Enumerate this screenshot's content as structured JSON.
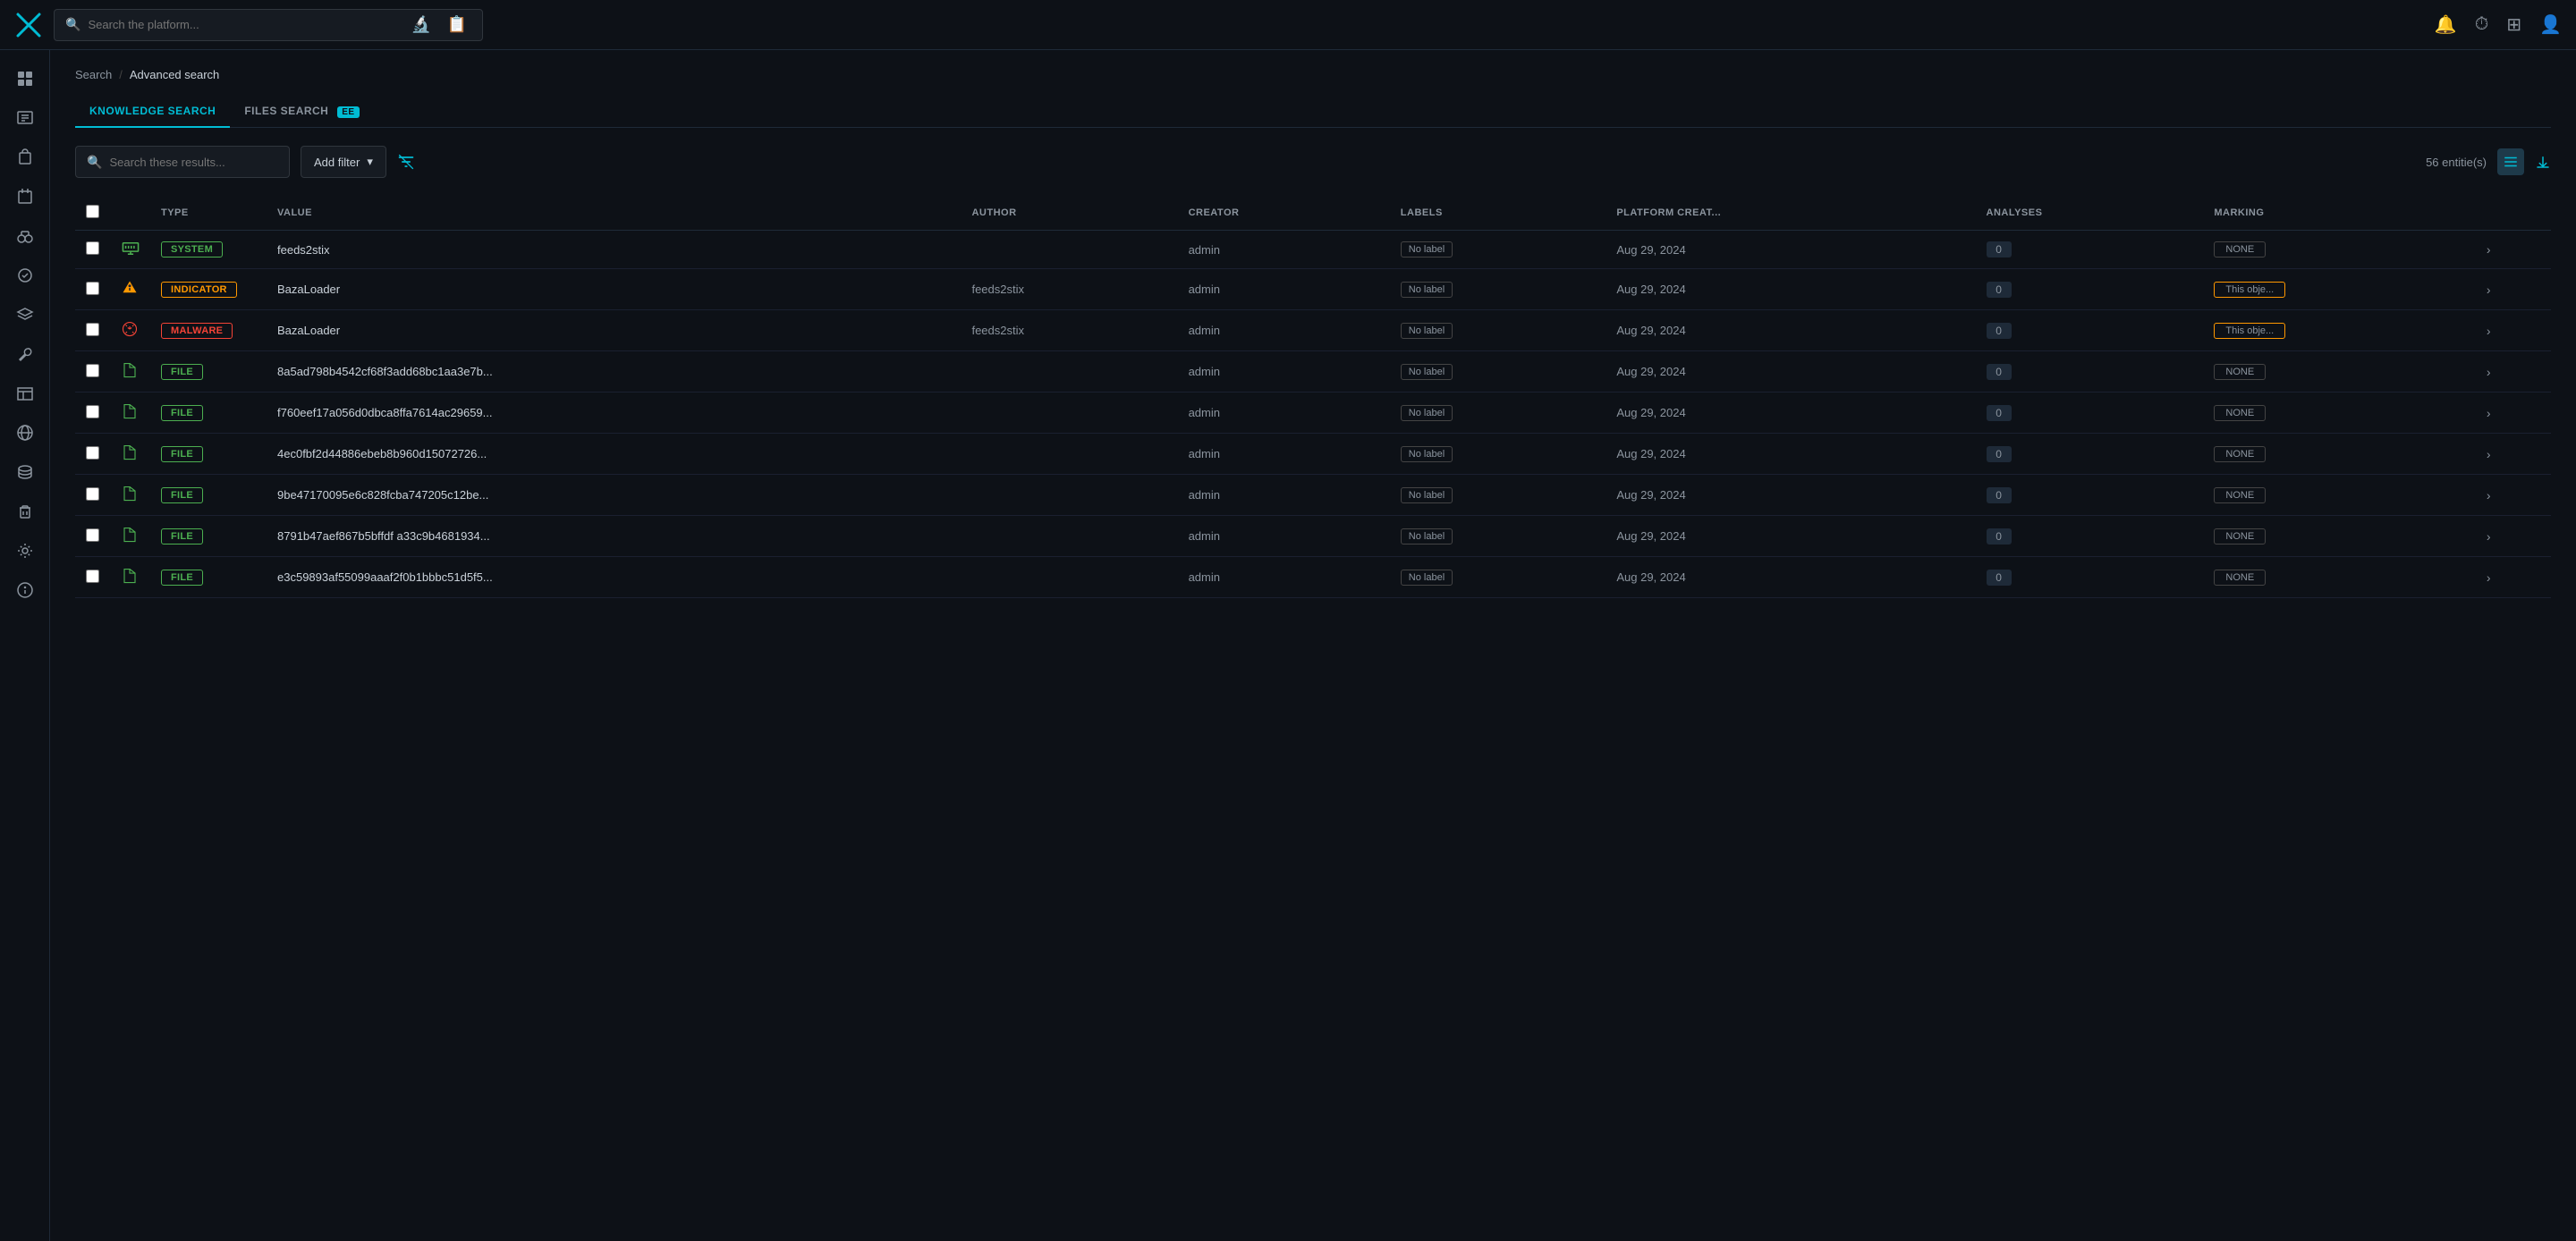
{
  "app": {
    "logo_alt": "X Logo"
  },
  "topnav": {
    "search_placeholder": "Search the platform...",
    "nav_icons": [
      "microscope",
      "clipboard-search",
      "bell",
      "clock",
      "grid",
      "user"
    ]
  },
  "sidebar": {
    "items": [
      {
        "name": "dashboard",
        "icon": "⊞"
      },
      {
        "name": "alerts",
        "icon": "🔔"
      },
      {
        "name": "cases",
        "icon": "💼"
      },
      {
        "name": "incidents",
        "icon": "📋"
      },
      {
        "name": "binoculars",
        "icon": "🔭"
      },
      {
        "name": "activity",
        "icon": "🧪"
      },
      {
        "name": "layers",
        "icon": "◈"
      },
      {
        "name": "wrench",
        "icon": "🔧"
      },
      {
        "name": "table",
        "icon": "📊"
      },
      {
        "name": "globe",
        "icon": "🌐"
      },
      {
        "name": "database",
        "icon": "🗄"
      },
      {
        "name": "trash",
        "icon": "🗑"
      },
      {
        "name": "settings",
        "icon": "⚙"
      },
      {
        "name": "info",
        "icon": "ℹ"
      }
    ]
  },
  "breadcrumb": {
    "parent": "Search",
    "separator": "/",
    "current": "Advanced search"
  },
  "tabs": [
    {
      "id": "knowledge",
      "label": "KNOWLEDGE SEARCH",
      "active": true,
      "badge": null
    },
    {
      "id": "files",
      "label": "FILES SEARCH",
      "active": false,
      "badge": "EE"
    }
  ],
  "filter_bar": {
    "search_placeholder": "Search these results...",
    "add_filter_label": "Add filter",
    "entities_count": "56 entitie(s)"
  },
  "table": {
    "headers": [
      "",
      "",
      "TYPE",
      "VALUE",
      "AUTHOR",
      "CREATOR",
      "LABELS",
      "PLATFORM CREAT...",
      "ANALYSES",
      "MARKING",
      ""
    ],
    "rows": [
      {
        "type": "SYSTEM",
        "type_class": "badge-system",
        "icon": "system",
        "value": "feeds2stix",
        "author": "",
        "creator": "admin",
        "label": "No label",
        "date": "Aug 29, 2024",
        "analyses": "0",
        "marking": "NONE",
        "marking_class": "marking-none"
      },
      {
        "type": "INDICATOR",
        "type_class": "badge-indicator",
        "icon": "indicator",
        "value": "BazaLoader",
        "author": "feeds2stix",
        "creator": "admin",
        "label": "No label",
        "date": "Aug 29, 2024",
        "analyses": "0",
        "marking": "This obje...",
        "marking_class": "marking-obj"
      },
      {
        "type": "MALWARE",
        "type_class": "badge-malware",
        "icon": "malware",
        "value": "BazaLoader",
        "author": "feeds2stix",
        "creator": "admin",
        "label": "No label",
        "date": "Aug 29, 2024",
        "analyses": "0",
        "marking": "This obje...",
        "marking_class": "marking-obj"
      },
      {
        "type": "FILE",
        "type_class": "badge-file",
        "icon": "file",
        "value": "8a5ad798b4542cf68f3add68bc1aa3e7b...",
        "author": "",
        "creator": "admin",
        "label": "No label",
        "date": "Aug 29, 2024",
        "analyses": "0",
        "marking": "NONE",
        "marking_class": "marking-none"
      },
      {
        "type": "FILE",
        "type_class": "badge-file",
        "icon": "file",
        "value": "f760eef17a056d0dbca8ffa7614ac29659...",
        "author": "",
        "creator": "admin",
        "label": "No label",
        "date": "Aug 29, 2024",
        "analyses": "0",
        "marking": "NONE",
        "marking_class": "marking-none"
      },
      {
        "type": "FILE",
        "type_class": "badge-file",
        "icon": "file",
        "value": "4ec0fbf2d44886ebeb8b960d15072726...",
        "author": "",
        "creator": "admin",
        "label": "No label",
        "date": "Aug 29, 2024",
        "analyses": "0",
        "marking": "NONE",
        "marking_class": "marking-none"
      },
      {
        "type": "FILE",
        "type_class": "badge-file",
        "icon": "file",
        "value": "9be47170095e6c828fcba747205c12be...",
        "author": "",
        "creator": "admin",
        "label": "No label",
        "date": "Aug 29, 2024",
        "analyses": "0",
        "marking": "NONE",
        "marking_class": "marking-none"
      },
      {
        "type": "FILE",
        "type_class": "badge-file",
        "icon": "file",
        "value": "8791b47aef867b5bffdf a33c9b4681934...",
        "author": "",
        "creator": "admin",
        "label": "No label",
        "date": "Aug 29, 2024",
        "analyses": "0",
        "marking": "NONE",
        "marking_class": "marking-none"
      },
      {
        "type": "FILE",
        "type_class": "badge-file",
        "icon": "file",
        "value": "e3c59893af55099aaaf2f0b1bbbc51d5f5...",
        "author": "",
        "creator": "admin",
        "label": "No label",
        "date": "Aug 29, 2024",
        "analyses": "0",
        "marking": "NONE",
        "marking_class": "marking-none"
      }
    ]
  },
  "icons": {
    "search": "🔍",
    "chevron_down": "▾",
    "no_filter": "⊘",
    "list_view": "≡",
    "download": "⬇",
    "arrow_right": "›"
  }
}
